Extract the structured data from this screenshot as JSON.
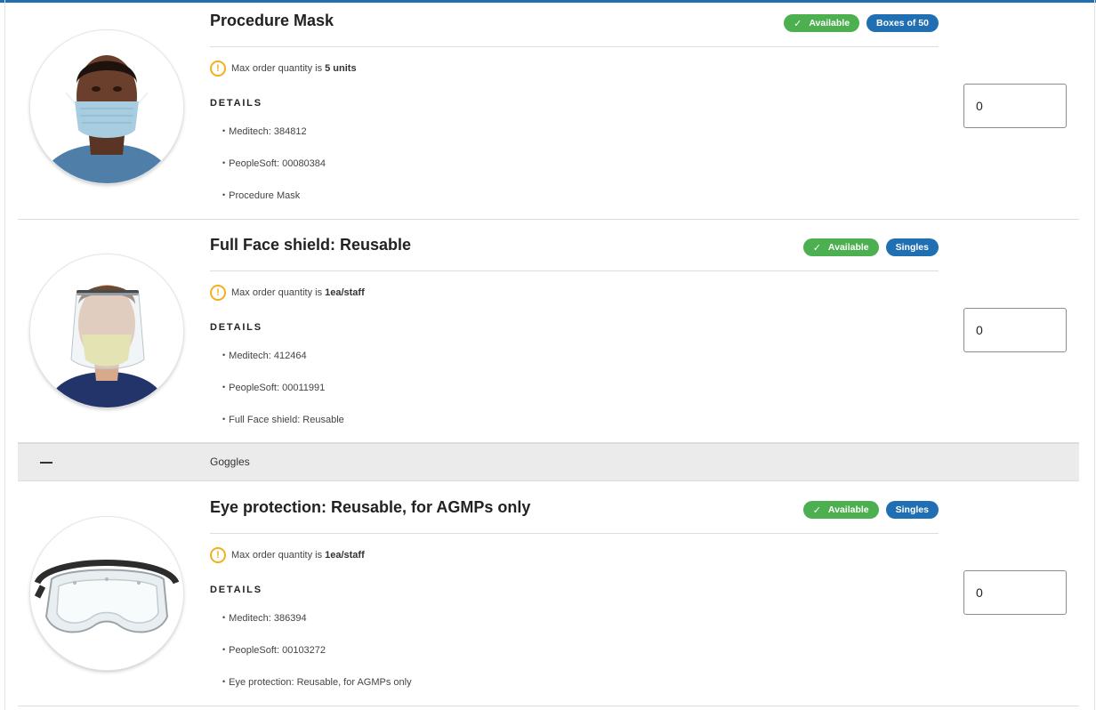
{
  "products": [
    {
      "title": "Procedure Mask",
      "status": "Available",
      "pack": "Boxes of 50",
      "notice_prefix": "Max order quantity is",
      "notice_value": "5 units",
      "details_heading": "DETAILS",
      "details": [
        "Meditech: 384812",
        "PeopleSoft: 00080384",
        "Procedure Mask"
      ],
      "quantity": "0",
      "image": "person-wearing-procedure-mask"
    },
    {
      "title": "Full Face shield: Reusable",
      "status": "Available",
      "pack": "Singles",
      "notice_prefix": "Max order quantity is",
      "notice_value": "1ea/staff",
      "details_heading": "DETAILS",
      "details": [
        "Meditech: 412464",
        "PeopleSoft: 00011991",
        "Full Face shield: Reusable"
      ],
      "quantity": "0",
      "image": "person-wearing-face-shield"
    },
    {
      "title": "Eye protection: Reusable, for AGMPs only",
      "status": "Available",
      "pack": "Singles",
      "notice_prefix": "Max order quantity is",
      "notice_value": "1ea/staff",
      "details_heading": "DETAILS",
      "details": [
        "Meditech: 386394",
        "PeopleSoft: 00103272",
        "Eye protection: Reusable, for AGMPs only"
      ],
      "quantity": "0",
      "image": "safety-goggles"
    }
  ],
  "group": {
    "label": "Goggles",
    "icon": "collapse-minus-icon"
  },
  "icons": {
    "status": "check-icon",
    "notice": "warning-circle-icon"
  },
  "colors": {
    "accent": "#1f6fb2",
    "available": "#4caf50",
    "warning": "#f2b01e",
    "group_bg": "#ebebeb"
  }
}
